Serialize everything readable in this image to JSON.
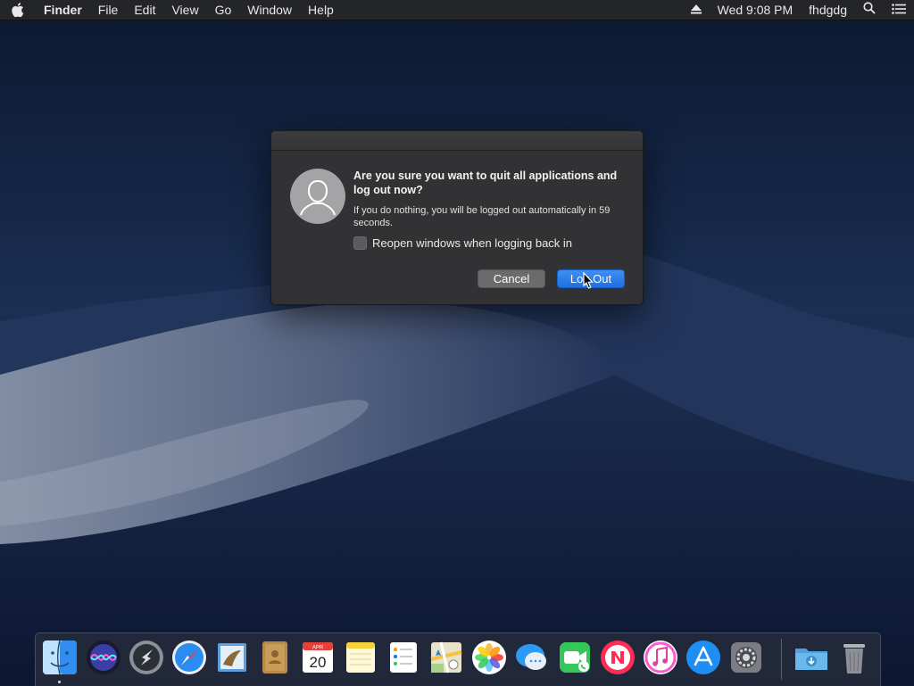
{
  "menubar": {
    "app_name": "Finder",
    "menus": [
      "File",
      "Edit",
      "View",
      "Go",
      "Window",
      "Help"
    ],
    "clock": "Wed 9:08 PM",
    "user": "fhdgdg"
  },
  "dialog": {
    "title": "Are you sure you want to quit all applications and log out now?",
    "message": "If you do nothing, you will be logged out automatically in 59 seconds.",
    "checkbox_label": "Reopen windows when logging back in",
    "checkbox_checked": false,
    "cancel_label": "Cancel",
    "primary_label": "Log Out"
  },
  "dock": {
    "items": [
      "finder-icon",
      "siri-icon",
      "launchpad-icon",
      "safari-icon",
      "mail-icon",
      "contacts-icon",
      "calendar-icon",
      "notes-icon",
      "reminders-icon",
      "maps-icon",
      "photos-icon",
      "messages-icon",
      "facetime-icon",
      "news-icon",
      "music-icon",
      "app-store-icon",
      "system-preferences-icon",
      "downloads-folder-icon",
      "trash-icon"
    ],
    "calendar_month": "APR",
    "calendar_day": "20"
  },
  "colors": {
    "accent": "#1e6fe0",
    "menubar": "#242528",
    "dialog_bg": "#323234"
  }
}
